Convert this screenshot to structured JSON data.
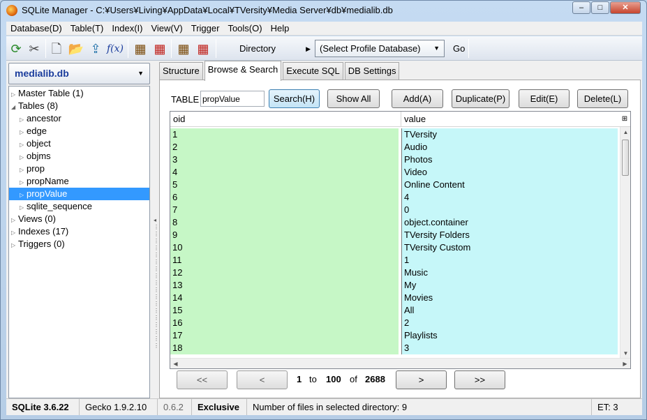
{
  "window": {
    "title": "SQLite Manager - C:¥Users¥Living¥AppData¥Local¥TVersity¥Media Server¥db¥medialib.db",
    "minimize": "–",
    "maximize": "□",
    "close": "✕"
  },
  "menu": [
    "Database(D)",
    "Table(T)",
    "Index(I)",
    "View(V)",
    "Trigger",
    "Tools(O)",
    "Help"
  ],
  "toolbar": {
    "directory_label": "Directory",
    "profile_select": "(Select Profile Database)",
    "go_label": "Go"
  },
  "db_select": "medialib.db",
  "tree": [
    {
      "label": "Master Table (1)",
      "twisty": "▷"
    },
    {
      "label": "Tables (8)",
      "twisty": "◢"
    },
    {
      "label": "ancestor",
      "twisty": "▷"
    },
    {
      "label": "edge",
      "twisty": "▷"
    },
    {
      "label": "object",
      "twisty": "▷"
    },
    {
      "label": "objms",
      "twisty": "▷"
    },
    {
      "label": "prop",
      "twisty": "▷"
    },
    {
      "label": "propName",
      "twisty": "▷"
    },
    {
      "label": "propValue",
      "twisty": "▷"
    },
    {
      "label": "sqlite_sequence",
      "twisty": "▷"
    },
    {
      "label": "Views (0)",
      "twisty": "▷"
    },
    {
      "label": "Indexes (17)",
      "twisty": "▷"
    },
    {
      "label": "Triggers (0)",
      "twisty": "▷"
    }
  ],
  "tabs": [
    "Structure",
    "Browse & Search",
    "Execute SQL",
    "DB Settings"
  ],
  "browse": {
    "table_label": "TABLE",
    "table_value": "propValue",
    "buttons": {
      "search": "Search(H)",
      "show_all": "Show All",
      "add": "Add(A)",
      "duplicate": "Duplicate(P)",
      "edit": "Edit(E)",
      "delete": "Delete(L)"
    },
    "columns": [
      "oid",
      "value"
    ],
    "rows": [
      [
        "1",
        "TVersity"
      ],
      [
        "2",
        "Audio"
      ],
      [
        "3",
        "Photos"
      ],
      [
        "4",
        "Video"
      ],
      [
        "5",
        "Online Content"
      ],
      [
        "6",
        "4"
      ],
      [
        "7",
        "0"
      ],
      [
        "8",
        "object.container"
      ],
      [
        "9",
        "TVersity Folders"
      ],
      [
        "10",
        "TVersity Custom"
      ],
      [
        "11",
        "1"
      ],
      [
        "12",
        "Music"
      ],
      [
        "13",
        "My"
      ],
      [
        "14",
        "Movies"
      ],
      [
        "15",
        "All"
      ],
      [
        "16",
        "2"
      ],
      [
        "17",
        "Playlists"
      ],
      [
        "18",
        "3"
      ]
    ]
  },
  "pager": {
    "first": "<<",
    "prev": "<",
    "from": "1",
    "to_label": "to",
    "to": "100",
    "of_label": "of",
    "total": "2688",
    "next": ">",
    "last": ">>"
  },
  "status": {
    "sqlite": "SQLite 3.6.22",
    "gecko": "Gecko 1.9.2.10",
    "version": "0.6.2",
    "mode": "Exclusive",
    "files": "Number of files in selected directory: 9",
    "et": "ET: 3"
  }
}
